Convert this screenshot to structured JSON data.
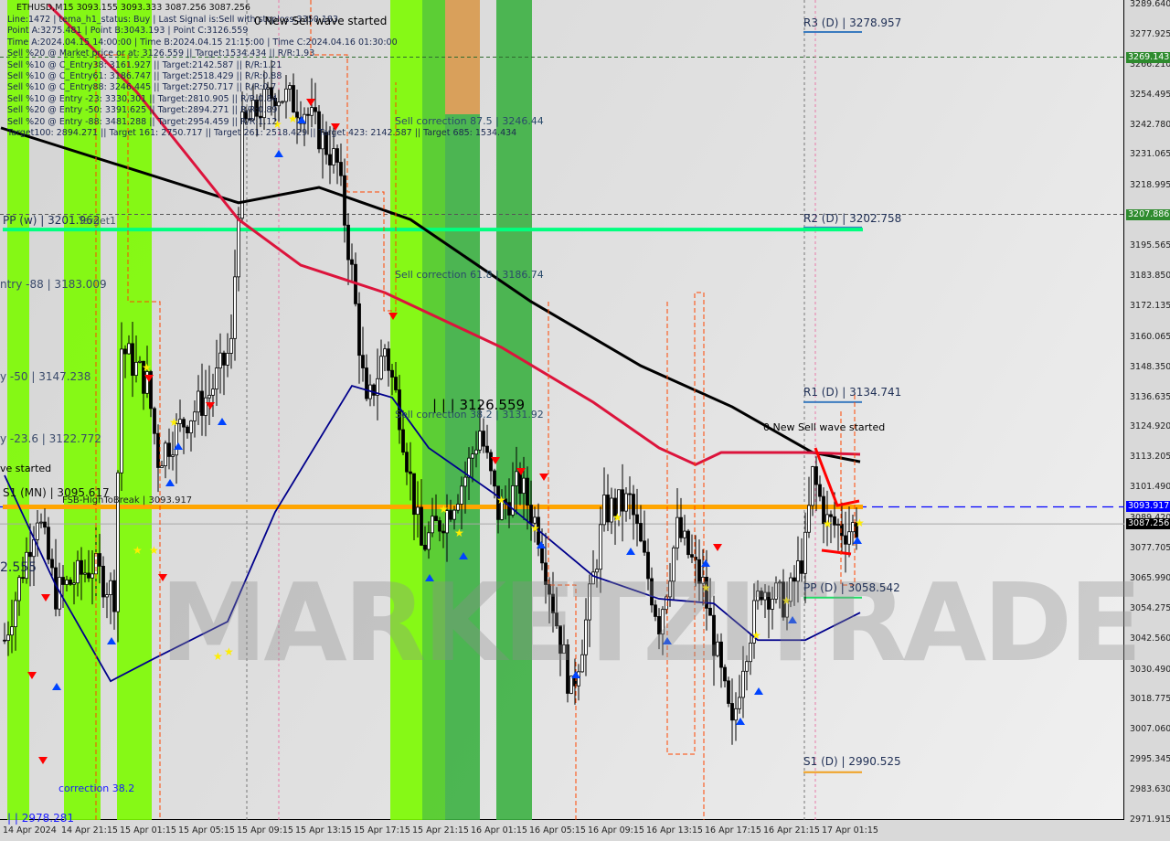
{
  "header": {
    "symbol_line": "ETHUSD,M15  3093.155 3093.333 3087.256 3087.256",
    "info_lines": [
      "Line:1472 | tema_h1_status: Buy | Last Signal is:Sell with stoploss:3350.183",
      "Point A:3275.481 | Point B:3043.193 | Point C:3126.559",
      "Time A:2024.04.15 14:00:00 | Time B:2024.04.15 21:15:00 | Time C:2024.04.16 01:30:00",
      "Sell %20 @ Market price or at: 3126.559 || Target:1534.434 || R/R:1.93",
      "Sell %10 @ C_Entry38: 3161.927 || Target:2142.587 || R/R:1.21",
      "Sell %10 @ C_Entry61: 3186.747 || Target:2518.429 || R/R:0.88",
      "Sell %10 @ C_Entry88: 3246.445 || Target:2750.717 || R/R:0.7",
      "Sell %10 @ Entry -23: 3330.301 || Target:2810.905 || R/R:0.84",
      "Sell %20 @ Entry -50: 3391.625 || Target:2894.271 || R/R:0.89",
      "Sell %20 @ Entry -88: 3481.288 || Target:2954.459 || R/R:1.12",
      "Target100: 2894.271 || Target 161: 2750.717 || Target 261: 2518.429 || Target 423: 2142.587 || Target 685: 1534.434"
    ]
  },
  "annotations": {
    "new_sell_top": "0 New Sell wave started",
    "new_sell_right": "0 New Sell wave started",
    "ve_started": "ve started",
    "r3": "R3 (D) | 3278.957",
    "r2": "R2 (D) | 3202.758",
    "r1": "R1 (D) | 3134.741",
    "pp_d": "PP (D) | 3058.542",
    "s1_d": "S1 (D) | 2990.525",
    "pp_w": "PP (w) | 3201.962",
    "target1": "Target1",
    "entry88": "ntry -88 | 3183.009",
    "entry50": "y -50 | 3147.238",
    "entry23": "y -23.6 | 3122.772",
    "s1_mn": "S1 (MN) | 3095.617",
    "fsb": "FSB-HighToBreak | 3093.917",
    "point_c": "| | | 3126.559",
    "corr875": "Sell correction 87.5 | 3246.44",
    "corr618": "Sell correction 61.8 | 3186.74",
    "corr382": "Sell correction 38.2 | 3131.92",
    "corr_blue": "correction 38.2",
    "left_255": "2.555",
    "bottom_left": "| | 2978.281",
    "watermark": "MARKETZITRADE"
  },
  "chart_data": {
    "type": "candlestick",
    "symbol": "ETHUSD",
    "timeframe": "M15",
    "ylim": [
      2971.915,
      3289.64
    ],
    "y_ticks": [
      "3289.640",
      "3277.925",
      "3266.210",
      "3254.495",
      "3242.780",
      "3231.065",
      "3218.995",
      "3207.886",
      "3195.565",
      "3183.850",
      "3172.135",
      "3160.065",
      "3148.350",
      "3136.635",
      "3124.920",
      "3113.205",
      "3101.490",
      "3089.420",
      "3077.705",
      "3065.990",
      "3054.275",
      "3042.560",
      "3030.490",
      "3018.775",
      "3007.060",
      "2995.345",
      "2983.630",
      "2971.915"
    ],
    "x_ticks": [
      "14 Apr 2024",
      "14 Apr 21:15",
      "15 Apr 01:15",
      "15 Apr 05:15",
      "15 Apr 09:15",
      "15 Apr 13:15",
      "15 Apr 17:15",
      "15 Apr 21:15",
      "16 Apr 01:15",
      "16 Apr 05:15",
      "16 Apr 09:15",
      "16 Apr 13:15",
      "16 Apr 17:15",
      "16 Apr 21:15",
      "17 Apr 01:15"
    ],
    "axis_tags": [
      {
        "value": "3269.143",
        "color": "#2e8b2e"
      },
      {
        "value": "3207.886",
        "color": "#2e8b2e"
      },
      {
        "value": "3093.917",
        "color": "#0000ff"
      },
      {
        "value": "3087.256",
        "color": "#000000"
      }
    ],
    "close_path": [
      [
        "2024-04-14 17:15",
        3042
      ],
      [
        "2024-04-14 19:30",
        3092
      ],
      [
        "2024-04-14 20:45",
        3060
      ],
      [
        "2024-04-14 23:15",
        3071
      ],
      [
        "2024-04-15 00:45",
        3060
      ],
      [
        "2024-04-15 01:15",
        3156
      ],
      [
        "2024-04-15 03:00",
        3142
      ],
      [
        "2024-04-15 03:45",
        3113
      ],
      [
        "2024-04-15 05:30",
        3127
      ],
      [
        "2024-04-15 07:15",
        3138
      ],
      [
        "2024-04-15 08:45",
        3156
      ],
      [
        "2024-04-15 09:30",
        3241
      ],
      [
        "2024-04-15 11:45",
        3256
      ],
      [
        "2024-04-15 13:45",
        3249
      ],
      [
        "2024-04-15 16:00",
        3227
      ],
      [
        "2024-04-15 17:00",
        3185
      ],
      [
        "2024-04-15 18:00",
        3131
      ],
      [
        "2024-04-15 19:15",
        3156
      ],
      [
        "2024-04-15 20:15",
        3131
      ],
      [
        "2024-04-15 21:45",
        3078
      ],
      [
        "2024-04-15 23:30",
        3092
      ],
      [
        "2024-04-16 00:45",
        3106
      ],
      [
        "2024-04-16 01:45",
        3124
      ],
      [
        "2024-04-16 03:00",
        3092
      ],
      [
        "2024-04-16 04:30",
        3103
      ],
      [
        "2024-04-16 05:45",
        3085
      ],
      [
        "2024-04-16 07:00",
        3049
      ],
      [
        "2024-04-16 08:00",
        3021
      ],
      [
        "2024-04-16 09:00",
        3049
      ],
      [
        "2024-04-16 10:15",
        3092
      ],
      [
        "2024-04-16 12:00",
        3096
      ],
      [
        "2024-04-16 12:45",
        3078
      ],
      [
        "2024-04-16 14:00",
        3049
      ],
      [
        "2024-04-16 15:15",
        3085
      ],
      [
        "2024-04-16 17:00",
        3063
      ],
      [
        "2024-04-16 19:00",
        3006
      ],
      [
        "2024-04-16 19:45",
        3035
      ],
      [
        "2024-04-16 21:00",
        3063
      ],
      [
        "2024-04-16 22:45",
        3056
      ],
      [
        "2024-04-17 00:00",
        3078
      ],
      [
        "2024-04-17 00:30",
        3106
      ],
      [
        "2024-04-17 01:30",
        3088
      ],
      [
        "2024-04-17 02:45",
        3085
      ],
      [
        "2024-04-17 03:45",
        3087.256
      ]
    ],
    "lines": [
      {
        "color": "#000000",
        "points": [
          [
            "2024-04-14 17:00",
            3241.6
          ],
          [
            "2024-04-15 09:15",
            3212.4
          ],
          [
            "2024-04-15 14:45",
            3218.4
          ],
          [
            "2024-04-15 21:00",
            3205.9
          ],
          [
            "2024-04-16 05:15",
            3173.9
          ],
          [
            "2024-04-16 12:45",
            3148.9
          ],
          [
            "2024-04-16 19:00",
            3132.9
          ],
          [
            "2024-04-17 00:30",
            3115.1
          ],
          [
            "2024-04-17 03:45",
            3111.5
          ]
        ]
      },
      {
        "color": "#dc143c",
        "points": [
          [
            "2024-04-14 20:15",
            3289.6
          ],
          [
            "2024-04-15 02:15",
            3255.8
          ],
          [
            "2024-04-15 09:15",
            3205.9
          ],
          [
            "2024-04-15 13:30",
            3188.1
          ],
          [
            "2024-04-15 19:15",
            3177.4
          ],
          [
            "2024-04-16 03:15",
            3156.0
          ],
          [
            "2024-04-16 09:30",
            3134.7
          ],
          [
            "2024-04-16 14:00",
            3116.9
          ],
          [
            "2024-04-16 16:30",
            3110.4
          ],
          [
            "2024-04-16 18:15",
            3115.1
          ],
          [
            "2024-04-17 00:00",
            3115.1
          ],
          [
            "2024-04-17 03:45",
            3114.4
          ]
        ]
      },
      {
        "color": "#00008b",
        "points": [
          [
            "2024-04-14 17:15",
            3106.2
          ],
          [
            "2024-04-14 20:45",
            3063.4
          ],
          [
            "2024-04-15 00:30",
            3026.0
          ],
          [
            "2024-04-15 03:30",
            3034.9
          ],
          [
            "2024-04-15 08:30",
            3049.2
          ],
          [
            "2024-04-15 11:45",
            3091.9
          ],
          [
            "2024-04-15 17:00",
            3141.1
          ],
          [
            "2024-04-15 19:45",
            3136.5
          ],
          [
            "2024-04-15 22:15",
            3116.9
          ],
          [
            "2024-04-16 02:45",
            3099.0
          ],
          [
            "2024-04-16 05:45",
            3084.8
          ],
          [
            "2024-04-16 09:30",
            3067.0
          ],
          [
            "2024-04-16 14:00",
            3058.1
          ],
          [
            "2024-04-16 17:45",
            3056.3
          ],
          [
            "2024-04-16 20:45",
            3042.0
          ],
          [
            "2024-04-17 00:00",
            3042.0
          ],
          [
            "2024-04-17 03:45",
            3052.7
          ]
        ]
      }
    ],
    "levels": [
      {
        "name": "R3 (D)",
        "value": 3278.957,
        "color": "#3a7bbf"
      },
      {
        "name": "R2 (D)",
        "value": 3202.758,
        "color": "#3a7bbf"
      },
      {
        "name": "R1 (D)",
        "value": 3134.741,
        "color": "#3a7bbf"
      },
      {
        "name": "PP (D)",
        "value": 3058.542,
        "color": "#22dd66"
      },
      {
        "name": "S1 (D)",
        "value": 2990.525,
        "color": "#f0a020"
      },
      {
        "name": "PP (w)",
        "value": 3201.962,
        "color": "#00ff7f"
      },
      {
        "name": "FSB-HighToBreak",
        "value": 3093.917,
        "color": "#ffa500"
      },
      {
        "name": "bid",
        "value": 3087.256,
        "color": "#a0a0a0"
      }
    ],
    "colors": {
      "bull_zone": "#7cfc00",
      "zone_dark": "#3cb043",
      "zone_orange": "#d9a05b",
      "stoploss_line": "#ff4500"
    }
  }
}
